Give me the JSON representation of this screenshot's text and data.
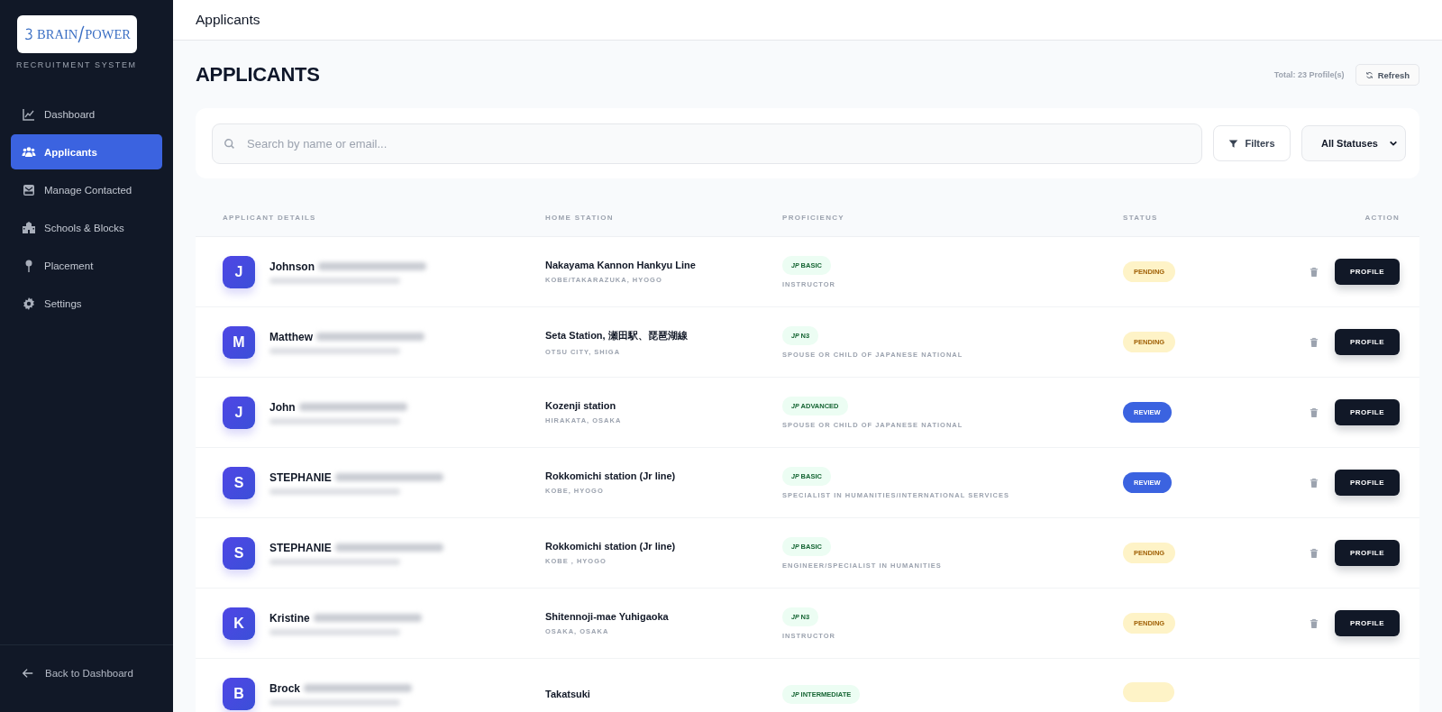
{
  "sidebar": {
    "logo": {
      "brand_left": "BRAIN",
      "brand_right": "POWER"
    },
    "subtitle": "RECRUITMENT SYSTEM",
    "items": [
      {
        "label": "Dashboard",
        "selected": false
      },
      {
        "label": "Applicants",
        "selected": true
      },
      {
        "label": "Manage Contacted",
        "selected": false
      },
      {
        "label": "Schools & Blocks",
        "selected": false
      },
      {
        "label": "Placement",
        "selected": false
      },
      {
        "label": "Settings",
        "selected": false
      }
    ],
    "back_link": "Back to Dashboard"
  },
  "header": {
    "title": "Applicants"
  },
  "page": {
    "heading": "APPLICANTS",
    "total": "Total: 23 Profile(s)",
    "refresh_button": "Refresh"
  },
  "search": {
    "placeholder": "Search by name or email...",
    "filters_button": "Filters",
    "status_select": "All Statuses"
  },
  "table": {
    "columns": [
      "APPLICANT DETAILS",
      "HOME STATION",
      "PROFICIENCY",
      "STATUS",
      "ACTION"
    ],
    "rows": [
      {
        "initial": "J",
        "first_name": "Johnson",
        "station": "Nakayama Kannon Hankyu Line",
        "area": "KOBE/TAKARAZUKA, HYOGO",
        "flag": "JP",
        "level": "BASIC",
        "visa": "INSTRUCTOR",
        "status": {
          "label": "PENDING",
          "kind": "pending"
        },
        "action": "PROFILE"
      },
      {
        "initial": "M",
        "first_name": "Matthew",
        "station": "Seta Station, 瀬田駅、琵琶湖線",
        "area": "OTSU CITY, SHIGA",
        "flag": "JP",
        "level": "N3",
        "visa": "SPOUSE OR CHILD OF JAPANESE NATIONAL",
        "status": {
          "label": "PENDING",
          "kind": "pending"
        },
        "action": "PROFILE"
      },
      {
        "initial": "J",
        "first_name": "John",
        "station": "Kozenji station",
        "area": "HIRAKATA, OSAKA",
        "flag": "JP",
        "level": "ADVANCED",
        "visa": "SPOUSE OR CHILD OF JAPANESE NATIONAL",
        "status": {
          "label": "REVIEW",
          "kind": "review"
        },
        "action": "PROFILE"
      },
      {
        "initial": "S",
        "first_name": "STEPHANIE",
        "station": "Rokkomichi station (Jr line)",
        "area": "KOBE, HYOGO",
        "flag": "JP",
        "level": "BASIC",
        "visa": "SPECIALIST IN HUMANITIES/INTERNATIONAL SERVICES",
        "status": {
          "label": "REVIEW",
          "kind": "review"
        },
        "action": "PROFILE"
      },
      {
        "initial": "S",
        "first_name": "STEPHANIE",
        "station": "Rokkomichi station (Jr line)",
        "area": "KOBE , HYOGO",
        "flag": "JP",
        "level": "BASIC",
        "visa": "ENGINEER/SPECIALIST IN HUMANITIES",
        "status": {
          "label": "PENDING",
          "kind": "pending"
        },
        "action": "PROFILE"
      },
      {
        "initial": "K",
        "first_name": "Kristine",
        "station": "Shitennoji-mae Yuhigaoka",
        "area": "OSAKA, OSAKA",
        "flag": "JP",
        "level": "N3",
        "visa": "INSTRUCTOR",
        "status": {
          "label": "PENDING",
          "kind": "pending"
        },
        "action": "PROFILE"
      },
      {
        "initial": "B",
        "first_name": "Brock",
        "station": "Takatsuki",
        "flag": "JP",
        "level": "INTERMEDIATE",
        "status": {
          "kind": "pending"
        }
      }
    ]
  }
}
